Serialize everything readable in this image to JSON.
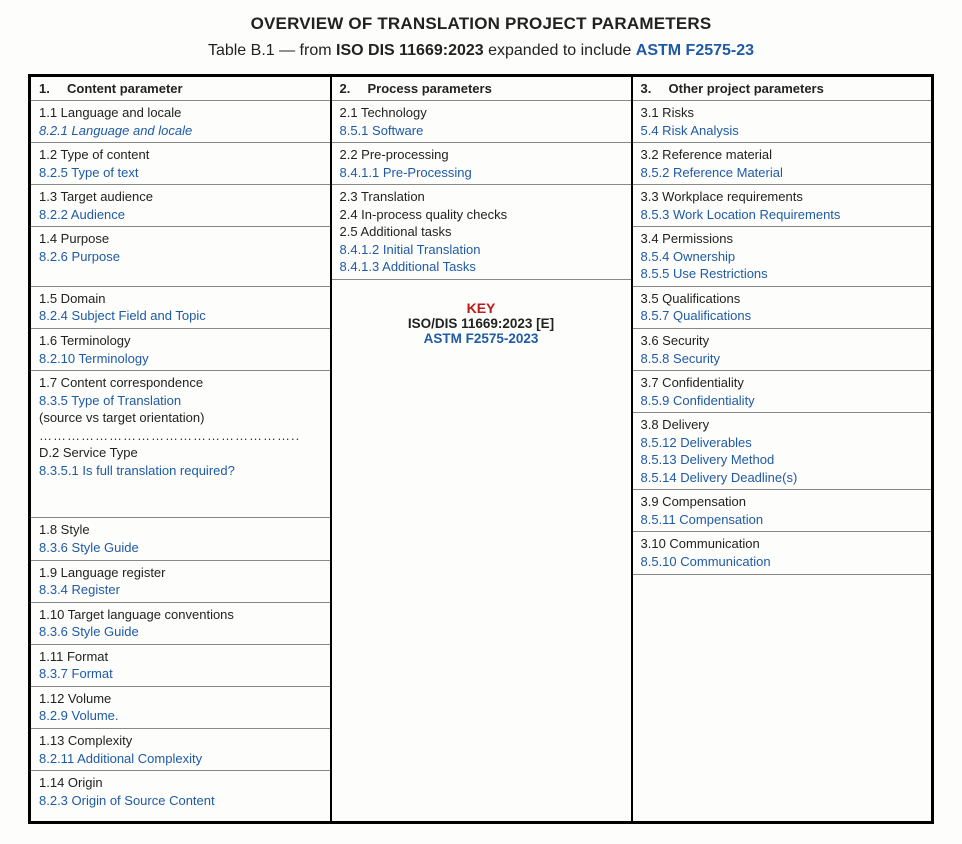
{
  "title": "OVERVIEW OF TRANSLATION PROJECT PARAMETERS",
  "caption": {
    "prefix": "Table B.1 — from ",
    "iso": "ISO DIS 11669:2023",
    "mid": " expanded to include ",
    "astm": "ASTM F2575-23"
  },
  "headers": {
    "c1": {
      "num": "1.",
      "label": "Content parameter"
    },
    "c2": {
      "num": "2.",
      "label": "Process parameters"
    },
    "c3": {
      "num": "3.",
      "label": "Other project parameters"
    }
  },
  "col1": {
    "r1": {
      "iso": "1.1 Language and locale",
      "astm": "8.2.1 Language and locale",
      "astm_italic": true
    },
    "r2": {
      "iso": "1.2 Type of content",
      "astm": "8.2.5 Type of text"
    },
    "r3": {
      "iso": "1.3 Target audience",
      "astm": "8.2.2 Audience"
    },
    "r4": {
      "iso": "1.4 Purpose",
      "astm": "8.2.6 Purpose",
      "extra_blank": true
    },
    "r5": {
      "iso": "1.5 Domain",
      "astm": "8.2.4 Subject Field and Topic"
    },
    "r6": {
      "iso": "1.6 Terminology",
      "astm": "8.2.10 Terminology"
    },
    "r7": {
      "iso": "1.7 Content correspondence",
      "astm": "8.3.5 Type of Translation",
      "note": "(source vs target orientation)",
      "dots": "………………………………………………..",
      "sub_iso": "D.2 Service Type",
      "sub_astm": "8.3.5.1 Is full translation required?",
      "trailing_blank": true
    },
    "r8": {
      "iso": "1.8 Style",
      "astm": "8.3.6 Style Guide"
    },
    "r9": {
      "iso": "1.9 Language register",
      "astm": "8.3.4 Register"
    },
    "r10": {
      "iso": "1.10 Target language conventions",
      "astm": "8.3.6 Style Guide"
    },
    "r11": {
      "iso": "1.11 Format",
      "astm": "8.3.7 Format"
    },
    "r12": {
      "iso": "1.12 Volume",
      "astm": "8.2.9 Volume."
    },
    "r13": {
      "iso": "1.13 Complexity",
      "astm": "8.2.11 Additional Complexity"
    },
    "r14": {
      "iso": "1.14 Origin",
      "astm": "8.2.3 Origin of Source Content"
    }
  },
  "col2": {
    "r1": {
      "iso": "2.1 Technology",
      "astm": "8.5.1 Software"
    },
    "r2": {
      "iso": "2.2 Pre-processing",
      "astm": "8.4.1.1 Pre-Processing"
    },
    "r3": {
      "iso1": "2.3 Translation",
      "iso2": "2.4 In-process quality checks",
      "iso3": "2.5 Additional tasks",
      "astm1": "8.4.1.2 Initial Translation",
      "astm2": "8.4.1.3 Additional Tasks"
    },
    "key": {
      "title": "KEY",
      "line1": "ISO/DIS 11669:2023 [E]",
      "line2": "ASTM F2575-2023"
    }
  },
  "col3": {
    "r1": {
      "iso": "3.1 Risks",
      "astm": "5.4 Risk Analysis"
    },
    "r2": {
      "iso": "3.2 Reference material",
      "astm": "8.5.2 Reference Material"
    },
    "r3": {
      "iso": "3.3 Workplace requirements",
      "astm": "8.5.3 Work Location Requirements"
    },
    "r4": {
      "iso": "3.4 Permissions",
      "astm1": "8.5.4 Ownership",
      "astm2": "8.5.5 Use Restrictions"
    },
    "r5": {
      "iso": "3.5 Qualifications",
      "astm": "8.5.7 Qualifications"
    },
    "r6": {
      "iso": "3.6 Security",
      "astm": "8.5.8 Security"
    },
    "r7": {
      "iso": "3.7 Confidentiality",
      "astm": "8.5.9 Confidentiality"
    },
    "r8": {
      "iso": "3.8 Delivery",
      "astm1": "8.5.12 Deliverables",
      "astm2": "8.5.13 Delivery Method",
      "astm3": "8.5.14 Delivery Deadline(s)"
    },
    "r9": {
      "iso": "3.9 Compensation",
      "astm": "8.5.11 Compensation"
    },
    "r10": {
      "iso": "3.10 Communication",
      "astm": "8.5.10 Communication"
    }
  }
}
